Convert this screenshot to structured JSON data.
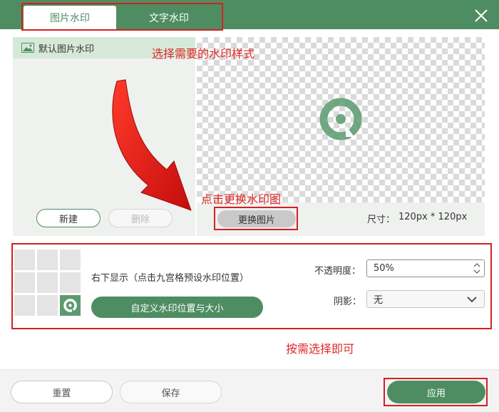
{
  "tabs": {
    "image_watermark": "图片水印",
    "text_watermark": "文字水印"
  },
  "list": {
    "default_item": "默认图片水印",
    "new_button": "新建",
    "delete_button": "删除"
  },
  "preview": {
    "change_button": "更换图片",
    "size_label": "尺寸：",
    "size_value": "120px * 120px"
  },
  "settings": {
    "position_text": "右下显示（点击九宫格预设水印位置）",
    "custom_button": "自定义水印位置与大小",
    "opacity_label": "不透明度：",
    "opacity_value": "50%",
    "shadow_label": "阴影：",
    "shadow_value": "无"
  },
  "footer": {
    "reset_button": "重置",
    "save_button": "保存",
    "apply_button": "应用"
  },
  "annotations": {
    "choose_style": "选择需要的水印样式",
    "click_change": "点击更换水印图",
    "choose_as_needed": "按需选择即可"
  },
  "colors": {
    "accent": "#4e8d62",
    "annotation": "#d42020"
  },
  "grid_active_cell": "bottom-right"
}
